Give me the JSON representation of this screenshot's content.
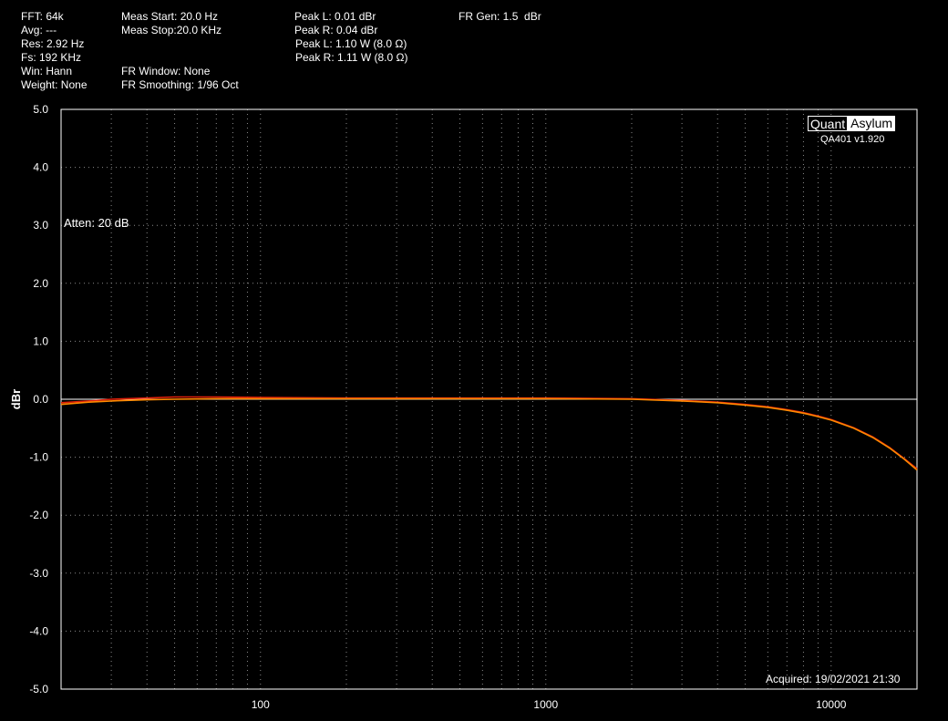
{
  "header": {
    "fft": "FFT: 64k",
    "avg": "Avg: ---",
    "res": "Res: 2.92 Hz",
    "fs": "Fs: 192 KHz",
    "win": "Win: Hann",
    "weight": "Weight: None",
    "meas_start": "Meas Start: 20.0 Hz",
    "meas_stop": "Meas Stop:20.0 KHz",
    "fr_window": "FR Window: None",
    "fr_smoothing": "FR Smoothing: 1/96 Oct",
    "peak_l_dbr": "Peak L: 0.01 dBr",
    "peak_r_dbr": "Peak R: 0.04 dBr",
    "peak_l_w": "Peak L: 1.10 W (8.0 Ω)",
    "peak_r_w": "Peak R: 1.11 W (8.0 Ω)",
    "fr_gen": "FR Gen: 1.5  dBr"
  },
  "logo": {
    "quant": "Quant",
    "asylum": "Asylum",
    "version": "QA401 v1.920"
  },
  "atten": "Atten: 20 dB",
  "acquired": "Acquired: 19/02/2021  21:30",
  "colors": {
    "background": "#000000",
    "grid": "#8a8a8a",
    "series_l": "#ff8a00",
    "series_r": "#e0200a",
    "reference": "#ffffff"
  },
  "chart_data": {
    "type": "line",
    "xscale": "log",
    "xlim": [
      20,
      20000
    ],
    "ylim": [
      -5,
      5
    ],
    "ylabel": "dBr",
    "yticks": [
      "5.0",
      "4.0",
      "3.0",
      "2.0",
      "1.0",
      "0.0",
      "-1.0",
      "-2.0",
      "-3.0",
      "-4.0",
      "-5.0"
    ],
    "xticks": [
      {
        "value": 100,
        "label": "100"
      },
      {
        "value": 1000,
        "label": "1000"
      },
      {
        "value": 10000,
        "label": "10000"
      }
    ],
    "grid": true,
    "reference_line": 0,
    "series": [
      {
        "color": "#ff8a00",
        "x": [
          20,
          25,
          30,
          40,
          50,
          70,
          100,
          200,
          500,
          1000,
          2000,
          3000,
          4000,
          5000,
          6000,
          7000,
          8000,
          9000,
          10000,
          12000,
          14000,
          16000,
          18000,
          20000
        ],
        "y": [
          -0.09,
          -0.05,
          -0.03,
          -0.01,
          0.0,
          0.01,
          0.01,
          0.01,
          0.01,
          0.01,
          0.0,
          -0.03,
          -0.06,
          -0.1,
          -0.14,
          -0.19,
          -0.24,
          -0.3,
          -0.36,
          -0.5,
          -0.66,
          -0.84,
          -1.03,
          -1.22
        ]
      },
      {
        "color": "#e0200a",
        "x": [
          20,
          25,
          30,
          40,
          50,
          70,
          100,
          200,
          500,
          1000,
          2000,
          3000,
          4000,
          5000,
          6000,
          7000,
          8000,
          9000,
          10000,
          12000,
          14000,
          16000,
          18000,
          20000
        ],
        "y": [
          -0.06,
          -0.03,
          0.0,
          0.02,
          0.04,
          0.04,
          0.03,
          0.02,
          0.02,
          0.02,
          0.01,
          -0.02,
          -0.05,
          -0.09,
          -0.13,
          -0.18,
          -0.23,
          -0.29,
          -0.35,
          -0.49,
          -0.65,
          -0.83,
          -1.02,
          -1.2
        ]
      }
    ]
  }
}
